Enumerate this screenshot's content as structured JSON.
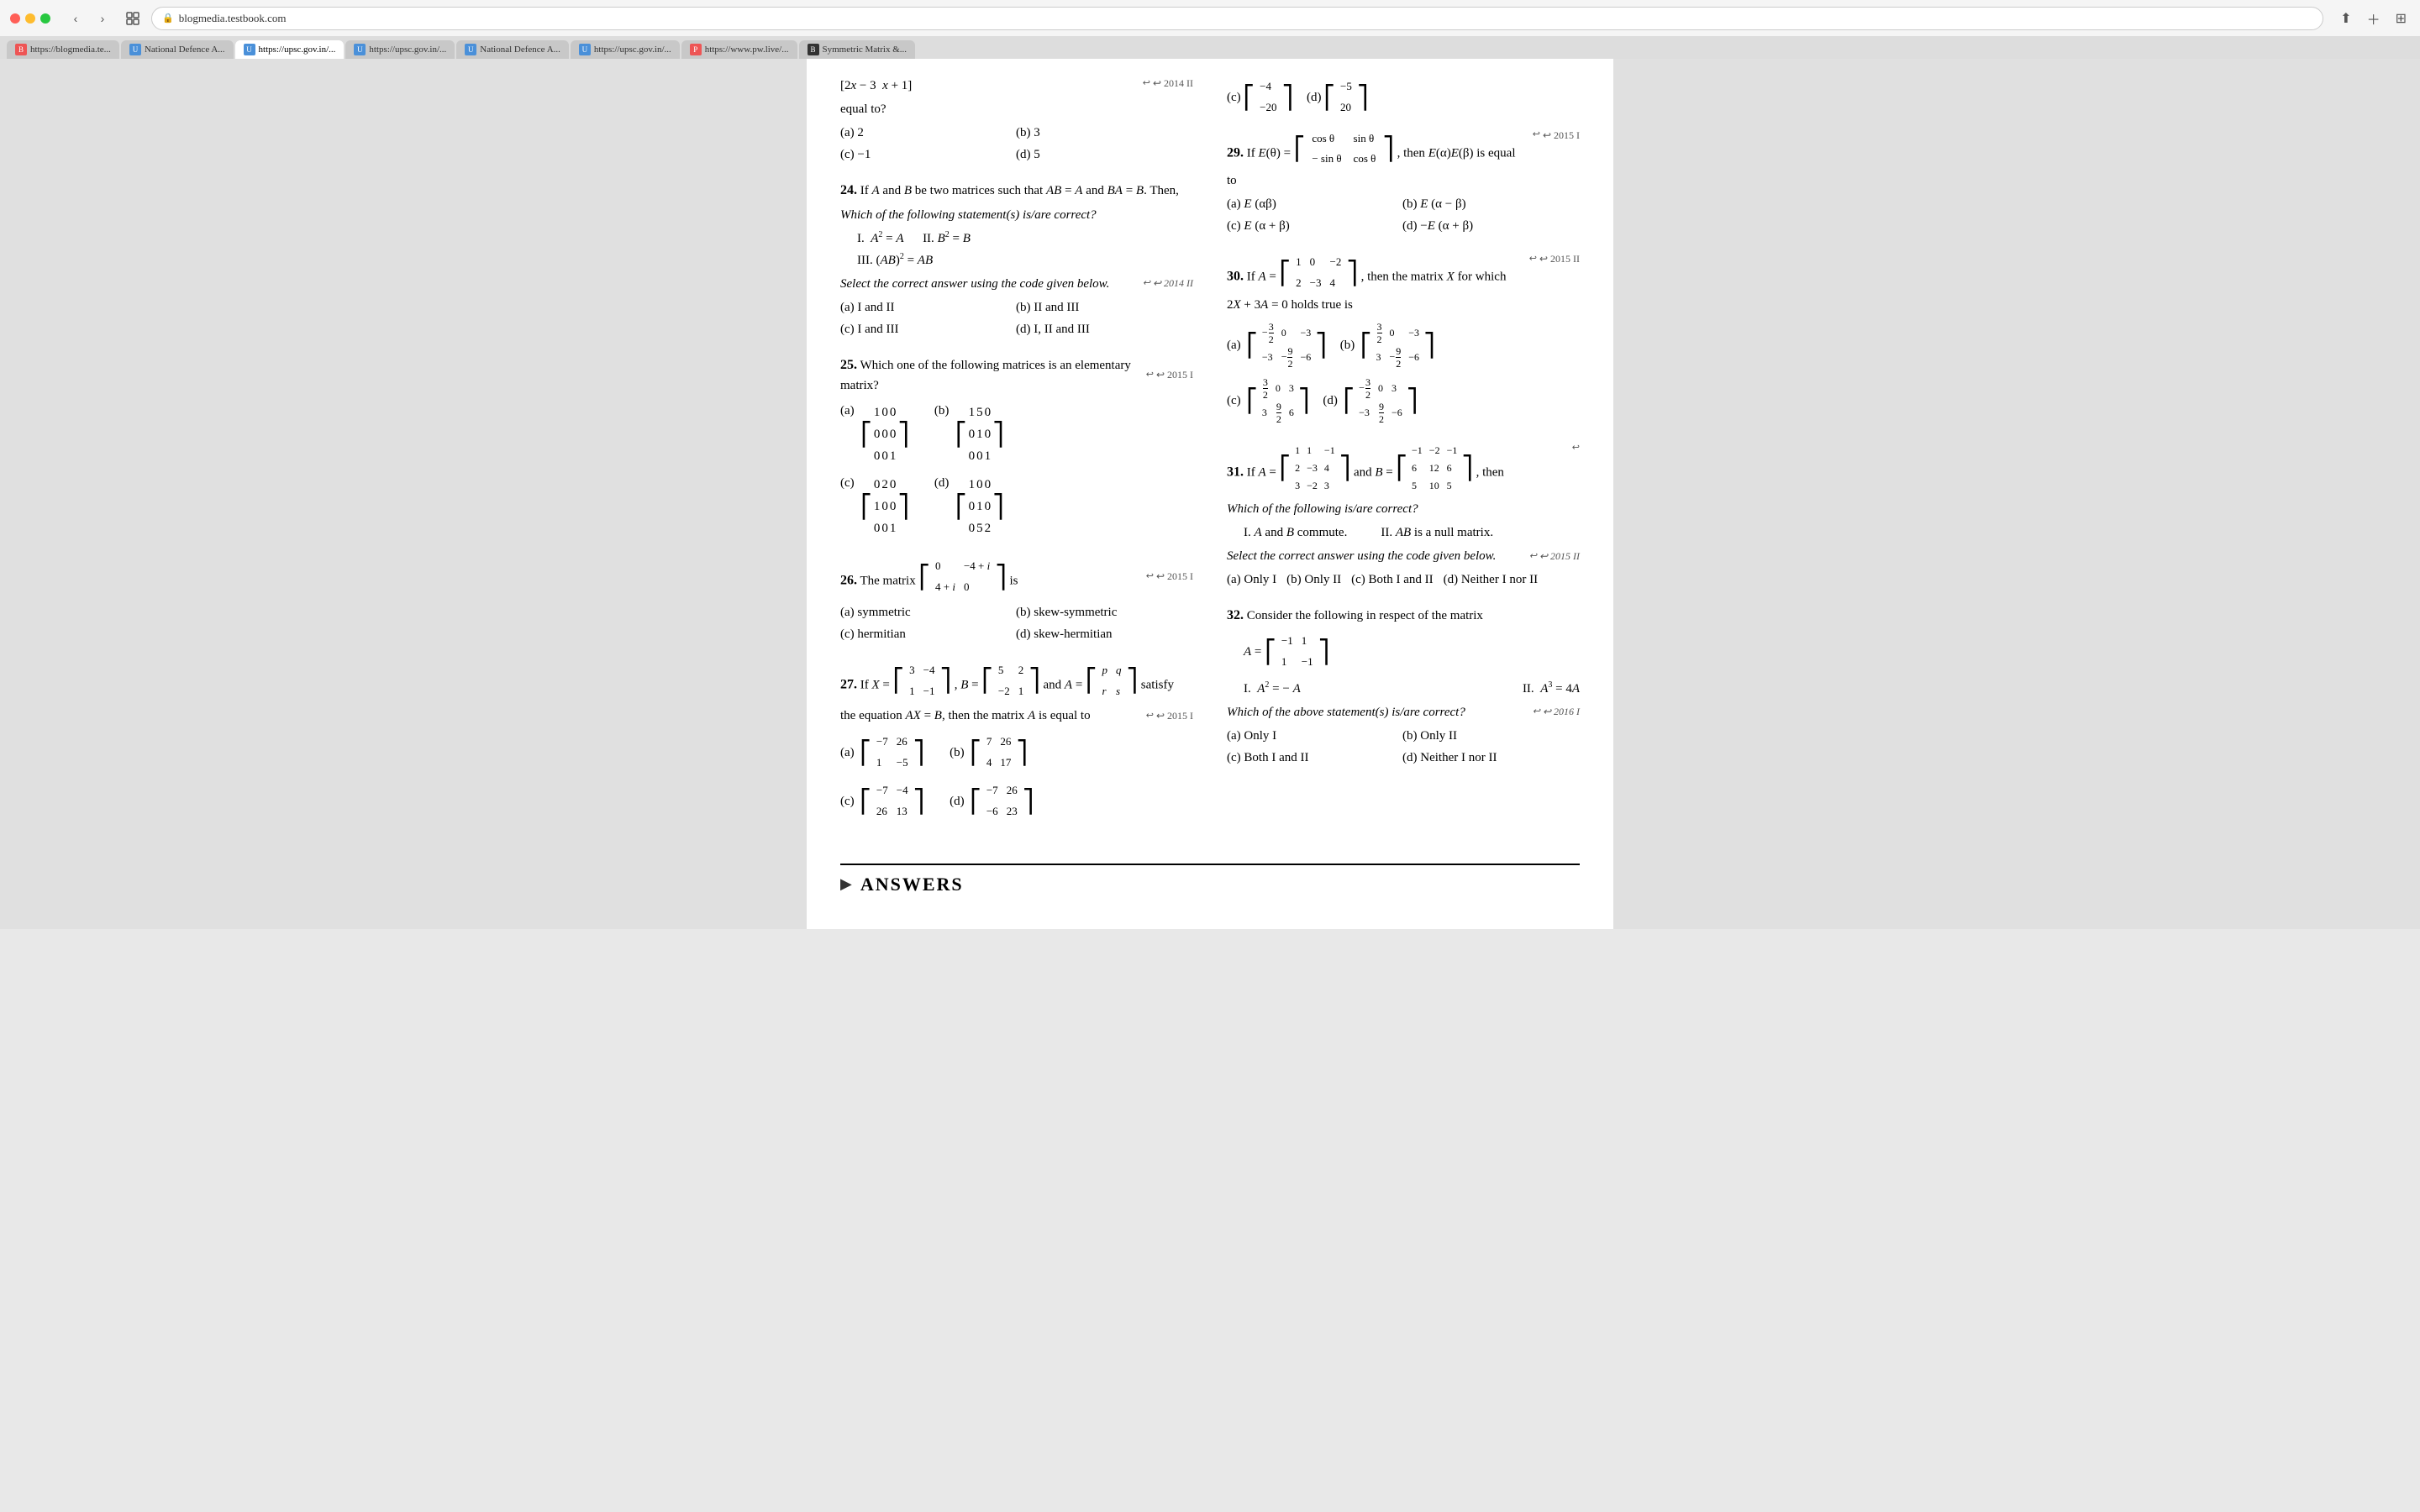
{
  "browser": {
    "url": "blogmedia.testbook.com",
    "tabs": [
      {
        "label": "https://blogmedia.te...",
        "favicon": "B",
        "favicon_color": "#e55",
        "active": false
      },
      {
        "label": "National Defence A...",
        "favicon": "U",
        "favicon_color": "#4a90d9",
        "active": false
      },
      {
        "label": "https://upsc.gov.in/...",
        "favicon": "U",
        "favicon_color": "#4a90d9",
        "active": true
      },
      {
        "label": "https://upsc.gov.in/...",
        "favicon": "U",
        "favicon_color": "#4a90d9",
        "active": false
      },
      {
        "label": "National Defence A...",
        "favicon": "U",
        "favicon_color": "#4a90d9",
        "active": false
      },
      {
        "label": "https://upsc.gov.in/...",
        "favicon": "U",
        "favicon_color": "#4a90d9",
        "active": false
      },
      {
        "label": "https://www.pw.live/...",
        "favicon": "P",
        "favicon_color": "#e55",
        "active": false
      },
      {
        "label": "Symmetric Matrix &...",
        "favicon": "B",
        "favicon_color": "#333",
        "active": false
      }
    ]
  },
  "page": {
    "questions": {
      "q24": {
        "number": "24.",
        "text": "If A and B be two matrices such that AB = A and BA = B. Then,",
        "subtext": "Which of the following statement(s) is/are correct?",
        "statements": [
          "I.  A² = A",
          "II. B² = B",
          "III. (AB)² = AB"
        ],
        "instruction": "Select the correct answer using the code given below.",
        "year": "2014 II",
        "options": [
          {
            "label": "(a)",
            "text": "I and II"
          },
          {
            "label": "(b)",
            "text": "II and III"
          },
          {
            "label": "(c)",
            "text": "I and III"
          },
          {
            "label": "(d)",
            "text": "I, II and III"
          }
        ]
      },
      "q25": {
        "number": "25.",
        "text": "Which one of the following matrices is an elementary matrix?",
        "year": "2015 I",
        "options_matrices": true
      },
      "q26": {
        "number": "26.",
        "text": "The matrix",
        "matrix": "[[0, -4+i],[4+i, 0]]",
        "suffix": "is",
        "year": "2015 I",
        "options": [
          {
            "label": "(a)",
            "text": "symmetric"
          },
          {
            "label": "(b)",
            "text": "skew-symmetric"
          },
          {
            "label": "(c)",
            "text": "hermitian"
          },
          {
            "label": "(d)",
            "text": "skew-hermitian"
          }
        ]
      },
      "q27": {
        "number": "27.",
        "text": "If X, B, A satisfy AX = B, then the matrix A is equal to",
        "year": "2015 I",
        "x_matrix": "[[3,-4],[1,-1]]",
        "b_matrix": "[[5,2],[-2,1]]",
        "a_matrix": "[[p,q],[r,s]]",
        "options_matrices": true
      },
      "q28_partial": {
        "text": "[2x-3 x+1]",
        "suffix": "equal to?",
        "year": "2014 II",
        "options": [
          {
            "label": "(a)",
            "text": "2"
          },
          {
            "label": "(b)",
            "text": "3"
          },
          {
            "label": "(c)",
            "text": "-1"
          },
          {
            "label": "(d)",
            "text": "5"
          }
        ]
      },
      "q29": {
        "number": "29.",
        "text": "If E(θ) = [[cosθ, sinθ],[-sinθ, cosθ]], then E(α)E(β) is equal to",
        "year": "2015 I",
        "options": [
          {
            "label": "(a)",
            "text": "E(αβ)"
          },
          {
            "label": "(b)",
            "text": "E(α − β)"
          },
          {
            "label": "(c)",
            "text": "E(α + β)"
          },
          {
            "label": "(d)",
            "text": "−E(α + β)"
          }
        ]
      },
      "q30": {
        "number": "30.",
        "text": "If A = [[1,0,-2],[2,-3,4]], then the matrix X for which 2X + 3A = 0 holds true is",
        "year": "2015 II",
        "options_matrices": true
      },
      "q31": {
        "number": "31.",
        "text": "If A and B are given matrices, then",
        "subtext": "Which of the following is/are correct?",
        "statements": [
          "I. A and B commute.",
          "II. AB is a null matrix."
        ],
        "instruction": "Select the correct answer using the code given below.",
        "year": "2015 II",
        "options": [
          {
            "label": "(a)",
            "text": "Only I"
          },
          {
            "label": "(b)",
            "text": "Only II"
          },
          {
            "label": "(c)",
            "text": "Both I and II"
          },
          {
            "label": "(d)",
            "text": "Neither I nor II"
          }
        ]
      },
      "q32": {
        "number": "32.",
        "text": "Consider the following in respect of the matrix",
        "a_matrix": "[[-1,1],[1,-1]]",
        "year": "2016 I",
        "statements": [
          "I. A² = −A",
          "II. A³ = 4A"
        ],
        "subtext": "Which of the above statement(s) is/are correct?",
        "options": [
          {
            "label": "(a)",
            "text": "Only I"
          },
          {
            "label": "(b)",
            "text": "Only II"
          },
          {
            "label": "(c)",
            "text": "Both I and II"
          },
          {
            "label": "(d)",
            "text": "Neither I nor II"
          }
        ]
      }
    },
    "answers_section": {
      "label": "ANSWERS",
      "arrow": "▶"
    }
  }
}
